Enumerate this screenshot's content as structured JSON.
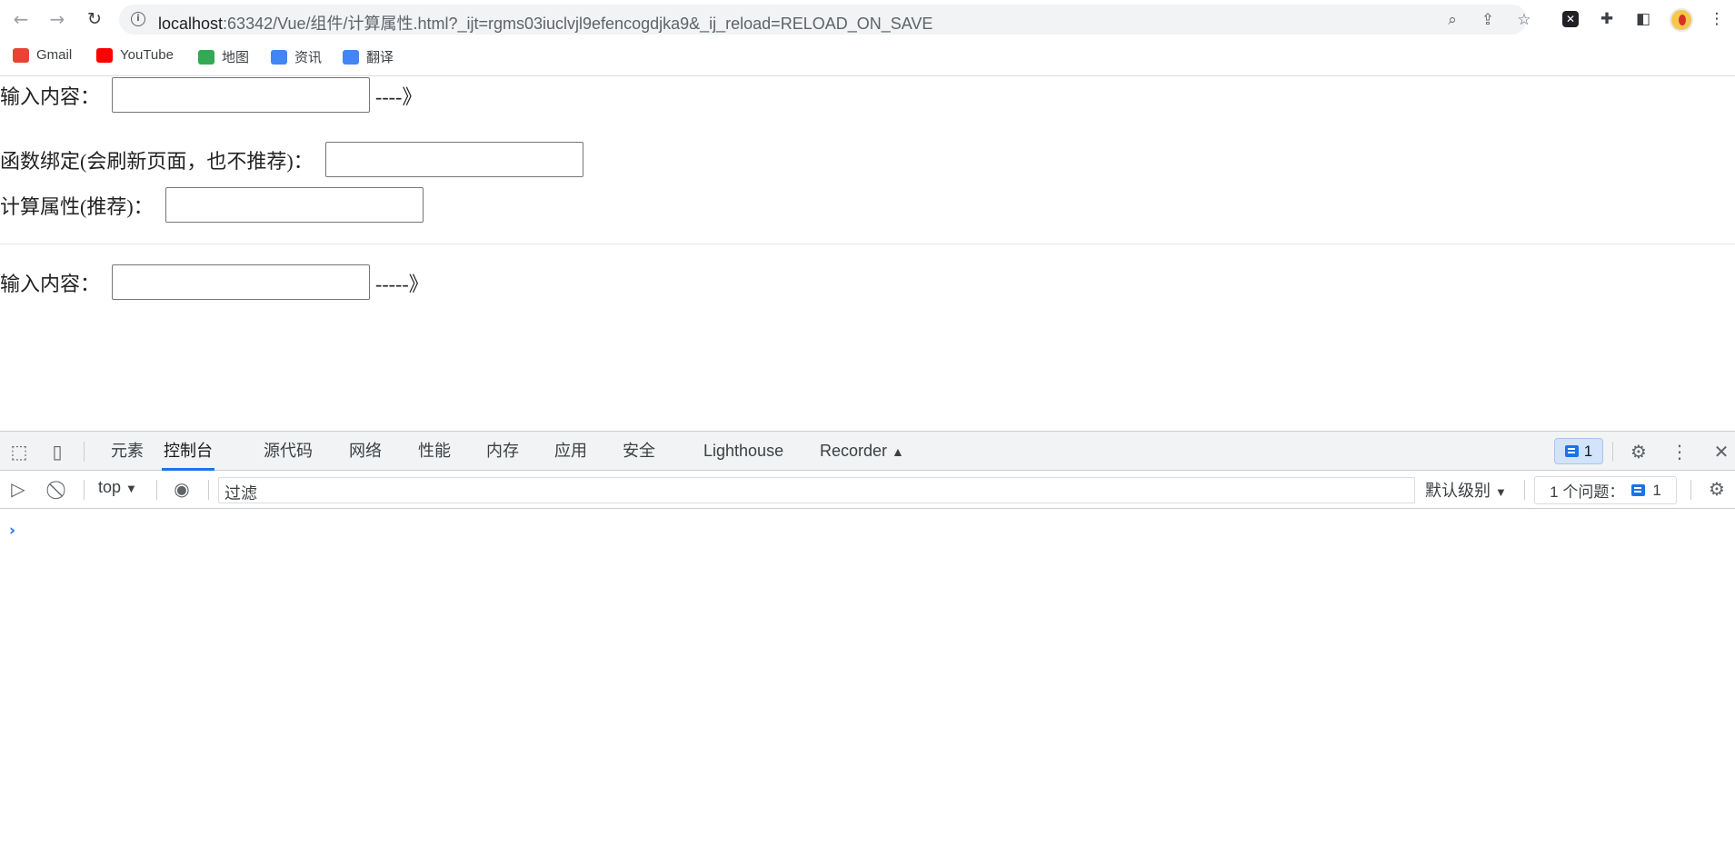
{
  "browser": {
    "url_host": "localhost",
    "url_rest": ":63342/Vue/组件/计算属性.html?_ijt=rgms03iuclvjl9efencogdjka9&_ij_reload=RELOAD_ON_SAVE",
    "bookmarks": [
      {
        "label": "Gmail",
        "color": "#ea4335"
      },
      {
        "label": "YouTube",
        "color": "#ff0000"
      },
      {
        "label": "地图",
        "color": "#34a853"
      },
      {
        "label": "资讯",
        "color": "#4285f4"
      },
      {
        "label": "翻译",
        "color": "#4285f4"
      }
    ]
  },
  "page": {
    "row1_label": "输入内容：",
    "row1_tail": "----》",
    "row2_label": "函数绑定(会刷新页面，也不推荐)：",
    "row3_label": "计算属性(推荐)：",
    "row4_label": "输入内容：",
    "row4_tail": "-----》"
  },
  "devtools": {
    "tabs": [
      "元素",
      "控制台",
      "源代码",
      "网络",
      "性能",
      "内存",
      "应用",
      "安全",
      "Lighthouse",
      "Recorder"
    ],
    "active_tab": "控制台",
    "issue_count": "1",
    "context": "top",
    "filter_placeholder": "过滤",
    "level": "默认级别",
    "issues_label": "1 个问题：",
    "issues_count": "1",
    "prompt": "›"
  }
}
